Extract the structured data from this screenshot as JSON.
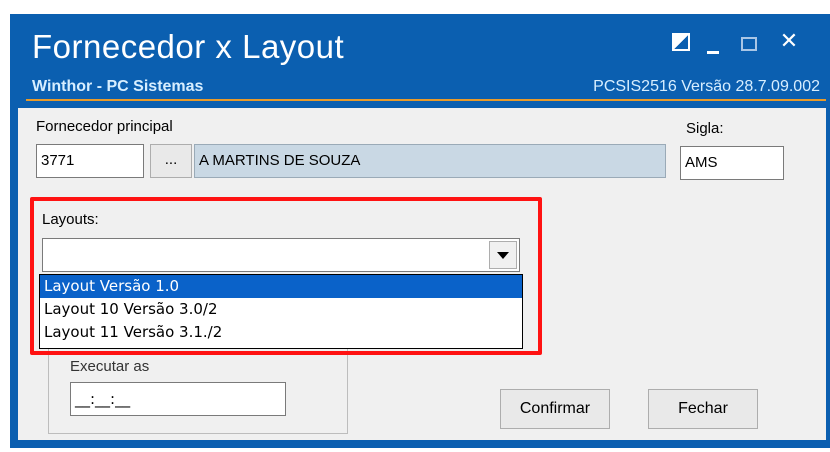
{
  "window": {
    "title": "Fornecedor x Layout",
    "subtitle": "Winthor - PC Sistemas",
    "version": "PCSIS2516  Versão  28.7.09.002",
    "controls": [
      "restore-icon",
      "minimize-icon",
      "maximize-icon",
      "close-icon"
    ],
    "close_glyph": "✕"
  },
  "form": {
    "fornecedor_label": "Fornecedor principal",
    "fornecedor_code": "3771",
    "lookup_button": "...",
    "fornecedor_name": "A MARTINS DE SOUZA",
    "sigla_label": "Sigla:",
    "sigla_value": "AMS",
    "layouts_label": "Layouts:",
    "layouts_value": "",
    "layout_options": [
      "Layout Versão 1.0",
      "Layout 10 Versão 3.0/2",
      "Layout 11 Versão 3.1./2"
    ],
    "selected_option_index": 0,
    "executar_label": "Executar as",
    "time_value": "__:__:__"
  },
  "buttons": {
    "confirm": "Confirmar",
    "close": "Fechar"
  },
  "colors": {
    "titlebar": "#0b5fb0",
    "accent_line": "#e89a2a",
    "highlight": "#ff1212",
    "selection": "#0a62c9"
  }
}
